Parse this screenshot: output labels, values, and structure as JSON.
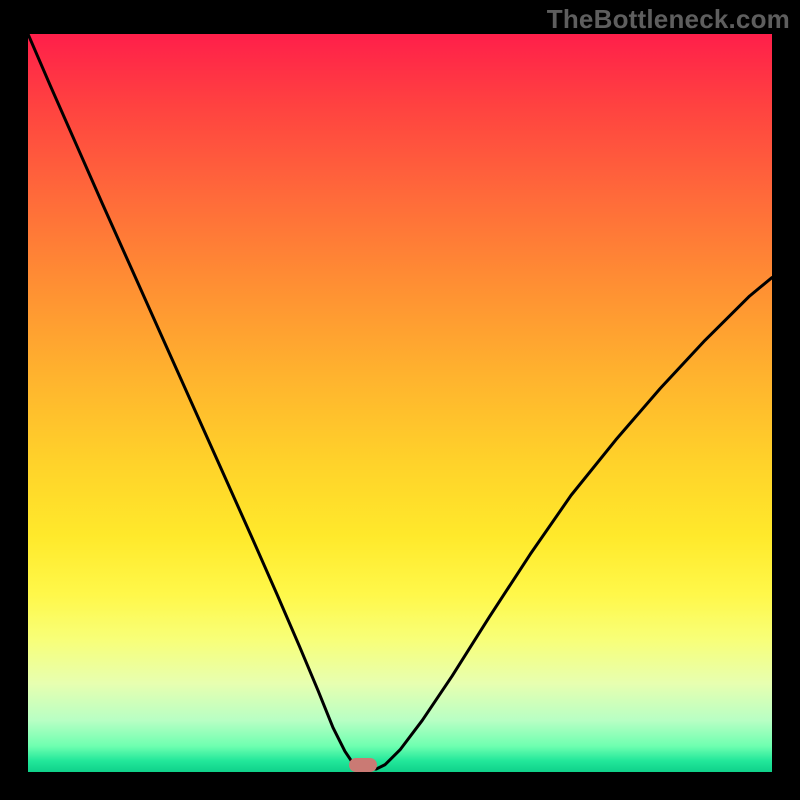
{
  "watermark": {
    "text": "TheBottleneck.com"
  },
  "chart_data": {
    "type": "line",
    "title": "",
    "xlabel": "",
    "ylabel": "",
    "xlim": [
      0,
      100
    ],
    "ylim": [
      0,
      100
    ],
    "gradient_stops": [
      {
        "pct": 0,
        "color": "#ff1f4a"
      },
      {
        "pct": 10,
        "color": "#ff4340"
      },
      {
        "pct": 22,
        "color": "#ff6a3a"
      },
      {
        "pct": 34,
        "color": "#ff8f33"
      },
      {
        "pct": 46,
        "color": "#ffb22e"
      },
      {
        "pct": 58,
        "color": "#ffd22a"
      },
      {
        "pct": 68,
        "color": "#ffe92b"
      },
      {
        "pct": 76,
        "color": "#fff84a"
      },
      {
        "pct": 82,
        "color": "#f8ff78"
      },
      {
        "pct": 88,
        "color": "#e7ffb0"
      },
      {
        "pct": 93,
        "color": "#b8ffc4"
      },
      {
        "pct": 96.5,
        "color": "#6effb0"
      },
      {
        "pct": 98.5,
        "color": "#22e79a"
      },
      {
        "pct": 100,
        "color": "#0fd18a"
      }
    ],
    "series": [
      {
        "name": "left-branch",
        "x": [
          0.0,
          3.0,
          6.5,
          10.0,
          14.0,
          18.0,
          22.0,
          26.0,
          30.0,
          33.5,
          36.5,
          39.0,
          41.0,
          42.6,
          43.8,
          44.6
        ],
        "y": [
          100.0,
          93.0,
          85.0,
          77.0,
          68.0,
          59.0,
          50.0,
          41.0,
          32.0,
          24.0,
          17.0,
          11.0,
          6.0,
          2.8,
          1.0,
          0.4
        ]
      },
      {
        "name": "right-branch",
        "x": [
          46.8,
          48.0,
          50.0,
          53.0,
          57.0,
          62.0,
          67.5,
          73.0,
          79.0,
          85.0,
          91.0,
          97.0,
          100.0
        ],
        "y": [
          0.4,
          1.0,
          3.0,
          7.0,
          13.0,
          21.0,
          29.5,
          37.5,
          45.0,
          52.0,
          58.5,
          64.5,
          67.0
        ]
      }
    ],
    "valley_flat": {
      "x_start": 44.6,
      "x_end": 46.8,
      "y": 0.4
    },
    "marker": {
      "x": 45.0,
      "y": 0.9,
      "color": "#ca7a74"
    },
    "curve_style": {
      "stroke": "#000000",
      "stroke_width": 3
    }
  }
}
